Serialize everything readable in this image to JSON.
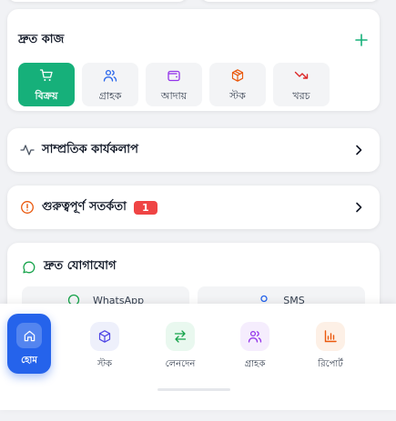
{
  "quick_actions": {
    "title": "দ্রুত কাজ",
    "items": [
      {
        "label": "বিক্রয়",
        "icon": "cart-icon",
        "active": true
      },
      {
        "label": "গ্রাহক",
        "icon": "users-icon",
        "active": false
      },
      {
        "label": "আদায়",
        "icon": "wallet-icon",
        "active": false
      },
      {
        "label": "স্টক",
        "icon": "box-icon",
        "active": false
      },
      {
        "label": "খরচ",
        "icon": "trending-down-icon",
        "active": false
      }
    ]
  },
  "recent_activity": {
    "title": "সাম্প্রতিক কার্যকলাপ",
    "icon": "activity-icon"
  },
  "alerts": {
    "title": "গুরুত্বপূর্ণ সতর্কতা",
    "count": "1",
    "icon": "alert-circle-icon"
  },
  "quick_contact": {
    "title": "দ্রুত যোগাযোগ",
    "icon": "chat-bubble-icon",
    "buttons": [
      {
        "label": "WhatsApp",
        "icon": "whatsapp-icon"
      },
      {
        "label": "SMS",
        "icon": "sms-icon"
      }
    ]
  },
  "bottom_nav": {
    "items": [
      {
        "label": "হোম",
        "icon": "home-icon",
        "active": true
      },
      {
        "label": "স্টক",
        "icon": "box-icon"
      },
      {
        "label": "লেনদেন",
        "icon": "transfer-icon"
      },
      {
        "label": "গ্রাহক",
        "icon": "users-icon"
      },
      {
        "label": "রিপোর্ট",
        "icon": "bar-chart-icon"
      }
    ]
  },
  "colors": {
    "accent_green": "#16b07a",
    "home_blue": "#2563eb",
    "alert_red": "#ef4444"
  }
}
